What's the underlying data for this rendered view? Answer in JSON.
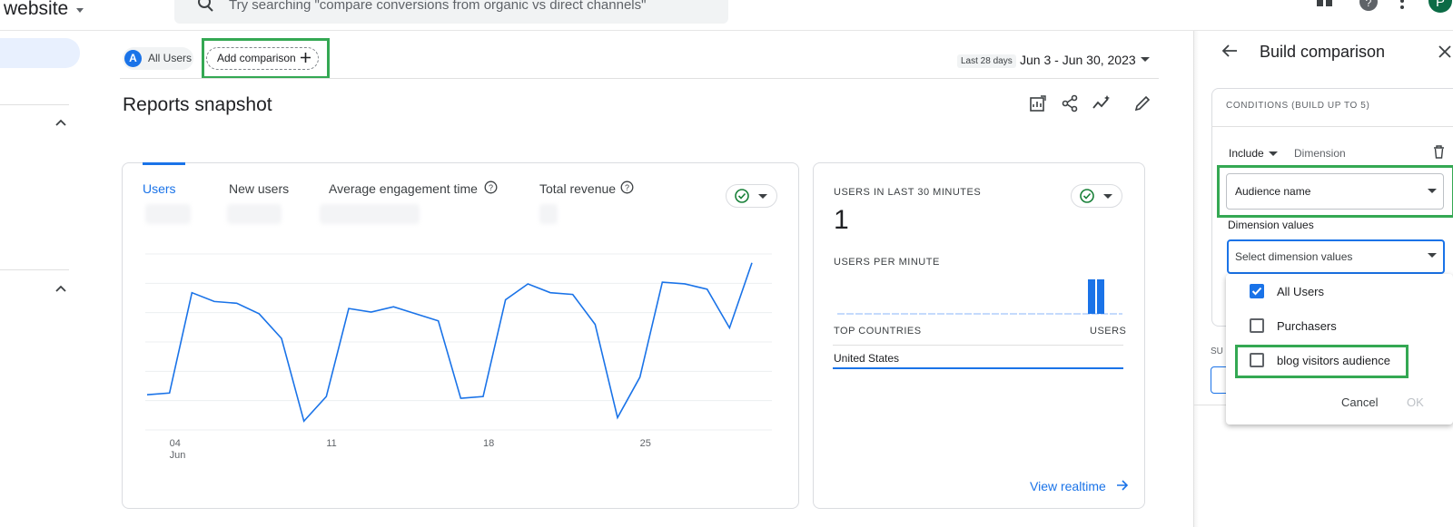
{
  "header": {
    "app_title": "website",
    "search_placeholder": "Try searching \"compare conversions from organic vs direct channels\"",
    "avatar_initial": "P"
  },
  "comparison_bar": {
    "all_users_initial": "A",
    "all_users_label": "All Users",
    "add_comparison_label": "Add comparison",
    "date_badge": "Last 28 days",
    "date_range": "Jun 3 - Jun 30, 2023"
  },
  "page": {
    "title": "Reports snapshot"
  },
  "main_card": {
    "tabs": [
      {
        "label": "Users"
      },
      {
        "label": "New users"
      },
      {
        "label": "Average engagement time"
      },
      {
        "label": "Total revenue"
      }
    ]
  },
  "chart_data": {
    "type": "line",
    "x_ticks": [
      {
        "label": "04",
        "sub": "Jun"
      },
      {
        "label": "11"
      },
      {
        "label": "18"
      },
      {
        "label": "25"
      }
    ],
    "x": [
      3,
      4,
      5,
      6,
      7,
      8,
      9,
      10,
      11,
      12,
      13,
      14,
      15,
      16,
      17,
      18,
      19,
      20,
      21,
      22,
      23,
      24,
      25,
      26,
      27,
      28,
      29,
      30
    ],
    "values": [
      0.2,
      0.21,
      0.78,
      0.73,
      0.72,
      0.66,
      0.52,
      0.05,
      0.19,
      0.69,
      0.67,
      0.7,
      0.66,
      0.62,
      0.18,
      0.19,
      0.74,
      0.83,
      0.78,
      0.77,
      0.6,
      0.07,
      0.3,
      0.84,
      0.83,
      0.8,
      0.58,
      0.95
    ],
    "grid": true
  },
  "realtime": {
    "users_heading": "USERS IN LAST 30 MINUTES",
    "users_value": "1",
    "per_minute_heading": "USERS PER MINUTE",
    "countries_heading": "TOP COUNTRIES",
    "users_col_heading": "USERS",
    "country": "United States",
    "view_link": "View realtime"
  },
  "panel": {
    "title": "Build comparison",
    "conditions_heading": "CONDITIONS (BUILD UP TO 5)",
    "include_label": "Include",
    "dimension_label": "Dimension",
    "dimension_value": "Audience name",
    "dimension_values_label": "Dimension values",
    "dimension_values_placeholder": "Select dimension values",
    "below_label": "SU",
    "options": [
      {
        "label": "All Users",
        "checked": true
      },
      {
        "label": "Purchasers",
        "checked": false
      },
      {
        "label": "blog visitors audience",
        "checked": false
      }
    ],
    "cancel_label": "Cancel",
    "ok_label": "OK"
  }
}
